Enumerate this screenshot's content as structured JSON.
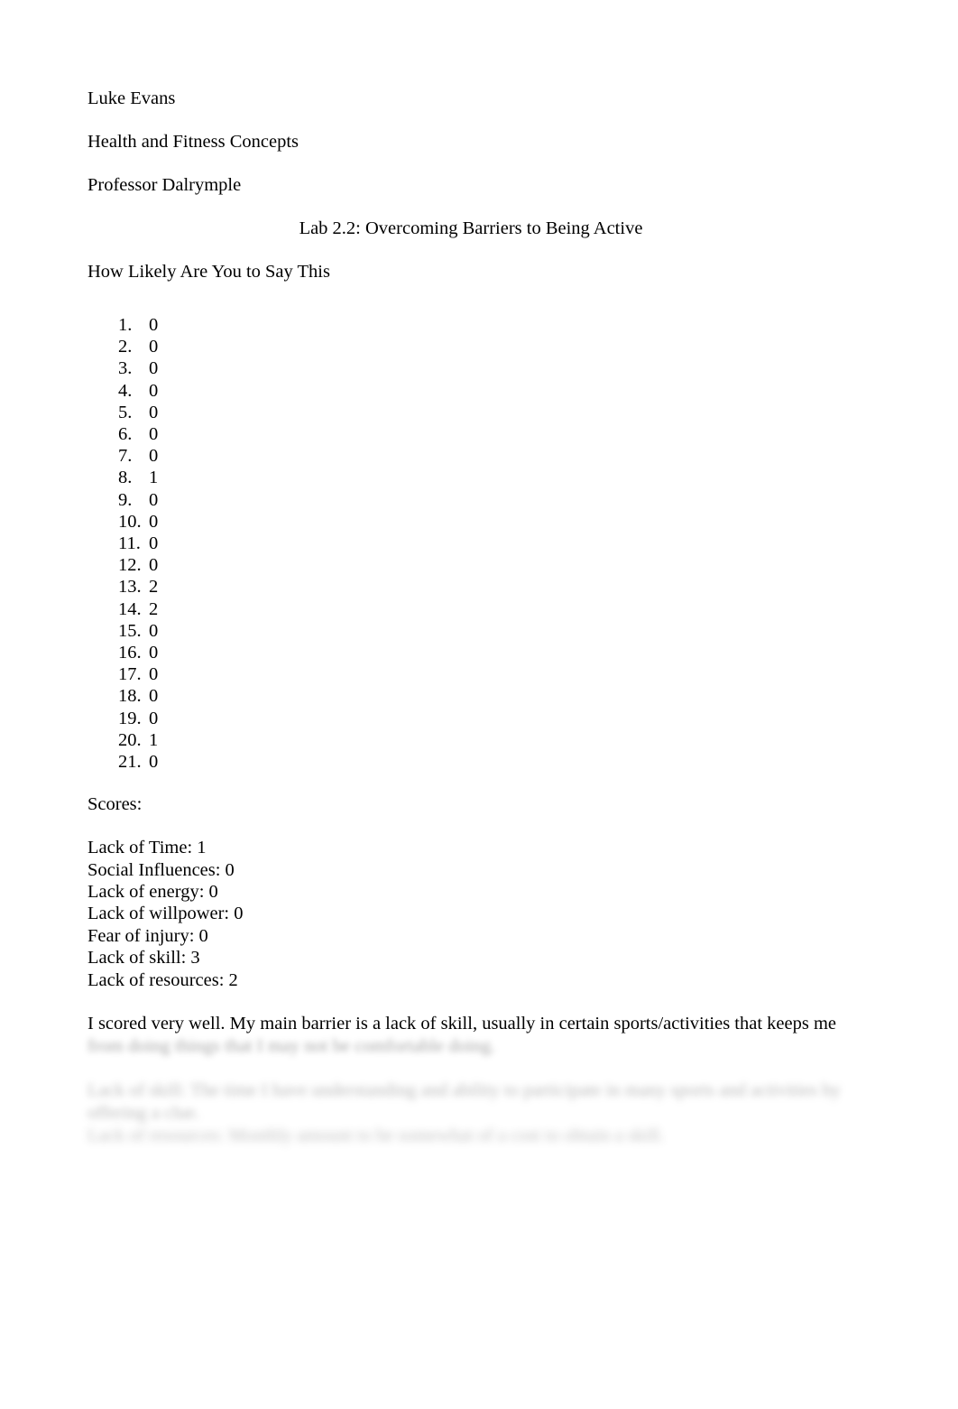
{
  "document": {
    "author": "Luke Evans",
    "course": "Health and Fitness Concepts",
    "instructor": "Professor Dalrymple",
    "title": "Lab 2.2: Overcoming Barriers to Being Active",
    "section_heading": "How Likely Are You to Say This",
    "questionnaire": {
      "items": [
        {
          "number": "1.",
          "value": "0"
        },
        {
          "number": "2.",
          "value": "0"
        },
        {
          "number": "3.",
          "value": "0"
        },
        {
          "number": "4.",
          "value": "0"
        },
        {
          "number": "5.",
          "value": "0"
        },
        {
          "number": "6.",
          "value": "0"
        },
        {
          "number": "7.",
          "value": "0"
        },
        {
          "number": "8.",
          "value": "1"
        },
        {
          "number": "9.",
          "value": "0"
        },
        {
          "number": "10.",
          "value": "0"
        },
        {
          "number": "11.",
          "value": "0"
        },
        {
          "number": "12.",
          "value": "0"
        },
        {
          "number": "13.",
          "value": "2"
        },
        {
          "number": "14.",
          "value": "2"
        },
        {
          "number": "15.",
          "value": "0"
        },
        {
          "number": "16.",
          "value": "0"
        },
        {
          "number": "17.",
          "value": "0"
        },
        {
          "number": "18.",
          "value": "0"
        },
        {
          "number": "19.",
          "value": "0"
        },
        {
          "number": "20.",
          "value": "1"
        },
        {
          "number": "21.",
          "value": "0"
        }
      ]
    },
    "scores_heading": "Scores:",
    "scores": [
      "Lack of Time: 1",
      "Social Influences: 0",
      "Lack of energy: 0",
      "Lack of willpower: 0",
      "Fear of injury: 0",
      "Lack of skill: 3",
      "Lack of resources: 2"
    ],
    "conclusion": {
      "line_1": "I scored very well. My main barrier is a lack of skill, usually in certain sports/activities that keeps me",
      "line_2_blurred": "from doing things that I may not be comfortable doing.",
      "line_3_blurred": "Lack of skill: The time I have understanding and ability to participate in many sports and activities by",
      "line_4_blurred": "offering a clue.",
      "line_5_blurred": "Lack of resources: Monthly amount to be somewhat of a cost to obtain a skill."
    }
  }
}
